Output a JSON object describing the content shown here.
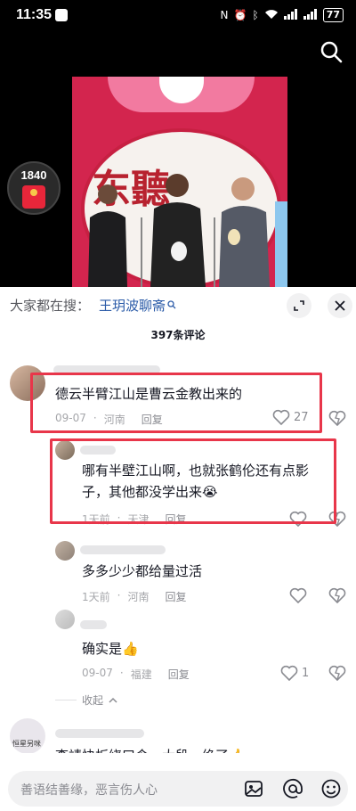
{
  "status_bar": {
    "time": "11:35",
    "battery": "77"
  },
  "video": {
    "red_packet_count": "1840",
    "stage_calligraphy": "东聽"
  },
  "sheet": {
    "search_label": "大家都在搜：",
    "search_keyword": "王玥波聊斋",
    "comment_count": "397条评论",
    "comments": [
      {
        "text": "德云半臂江山是曹云金教出来的",
        "date": "09-07",
        "location": "河南",
        "reply": "回复",
        "likes": "27"
      },
      {
        "text_line1": "哪有半壁江山啊，也就张鹤伦还有点影",
        "text_line2": "子，其他都没学出来😭",
        "date": "1天前",
        "location": "天津",
        "reply": "回复"
      },
      {
        "text": "多多少少都给量过活",
        "date": "1天前",
        "location": "河南",
        "reply": "回复"
      },
      {
        "text": "确实是👍",
        "date": "09-07",
        "location": "福建",
        "reply": "回复",
        "likes": "1"
      },
      {
        "text": "李靖快板绕口令一大段，绝了👍",
        "avatar_label": "恒星另咪"
      }
    ],
    "collapse": "收起"
  },
  "input_bar": {
    "placeholder": "善语结善缘，恶言伤人心"
  },
  "colors": {
    "highlight": "#e8364a",
    "link": "#2b5ba8",
    "stage": "#d3254e"
  }
}
